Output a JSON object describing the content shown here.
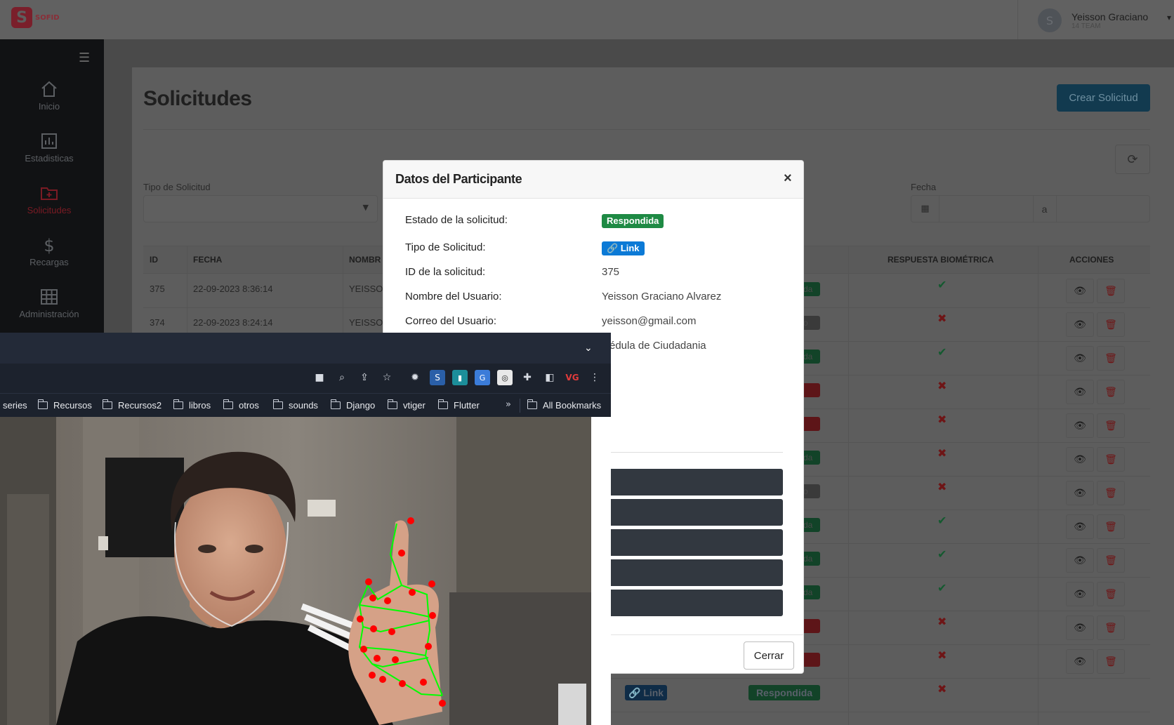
{
  "app": {
    "logo_text": "SOFID",
    "logo_letter": "S",
    "user_name": "Yeisson Graciano",
    "user_team": "14 TEAM",
    "user_initial": "S"
  },
  "sidebar": {
    "items": [
      {
        "label": "Inicio",
        "icon": "home-icon"
      },
      {
        "label": "Estadisticas",
        "icon": "chart-icon"
      },
      {
        "label": "Solicitudes",
        "icon": "folder-plus-icon"
      },
      {
        "label": "Recargas",
        "icon": "dollar-icon"
      },
      {
        "label": "Administración",
        "icon": "grid-icon"
      }
    ]
  },
  "page": {
    "title": "Solicitudes",
    "create_button": "Crear Solicitud",
    "filter_tipo_label": "Tipo de Solicitud",
    "filter_fecha_label": "Fecha",
    "date_separator": "a"
  },
  "table": {
    "headers": {
      "id": "ID",
      "fecha": "FECHA",
      "nombre": "NOMBR",
      "biometric": "RESPUESTA BIOMÉTRICA",
      "acciones": "ACCIONES"
    },
    "rows": [
      {
        "id": "375",
        "fecha": "22-09-2023 8:36:14",
        "nombre": "YEISSON",
        "edge": "da",
        "edge_color": "green",
        "ok": true
      },
      {
        "id": "374",
        "fecha": "22-09-2023 8:24:14",
        "nombre": "YEISSON",
        "edge": "o",
        "edge_color": "gray",
        "ok": false
      },
      {
        "edge": "da",
        "edge_color": "green",
        "ok": true
      },
      {
        "edge": "",
        "edge_color": "red",
        "ok": false
      },
      {
        "edge": "",
        "edge_color": "red",
        "ok": false
      },
      {
        "edge": "da",
        "edge_color": "green",
        "ok": false
      },
      {
        "edge": "o",
        "edge_color": "gray",
        "ok": false
      },
      {
        "edge": "da",
        "edge_color": "green",
        "ok": true
      },
      {
        "edge": "da",
        "edge_color": "green",
        "ok": true
      },
      {
        "edge": "da",
        "edge_color": "green",
        "ok": true
      },
      {
        "edge": "",
        "edge_color": "red",
        "ok": false
      },
      {
        "edge": "",
        "edge_color": "red",
        "ok": false
      },
      {
        "edge": "",
        "edge_color": "green",
        "ok": false
      }
    ],
    "last_row_tipo": "Link",
    "last_row_estado": "Respondida"
  },
  "modal": {
    "title": "Datos del Participante",
    "close_symbol": "×",
    "fields": [
      {
        "label": "Estado de la solicitud:",
        "value": "Respondida"
      },
      {
        "label": "Tipo de Solicitud:",
        "value": "Link"
      },
      {
        "label": "ID de la solicitud:",
        "value": "375"
      },
      {
        "label": "Nombre del Usuario:",
        "value": "Yeisson Graciano Alvarez"
      },
      {
        "label": "Correo del Usuario:",
        "value": "yeisson@gmail.com"
      },
      {
        "label": "",
        "value": "édula de Ciudadania"
      }
    ],
    "close_button": "Cerrar"
  },
  "browser": {
    "bookmarks": [
      "series",
      "Recursos",
      "Recursos2",
      "libros",
      "otros",
      "sounds",
      "Django",
      "vtiger",
      "Flutter"
    ],
    "overflow": "»",
    "all_bookmarks": "All Bookmarks"
  },
  "colors": {
    "accent_green": "#1e8a44",
    "accent_blue": "#0c7ad6",
    "danger": "#c0262d",
    "hand_landmark": "#ff0000",
    "hand_skeleton": "#00ff00"
  }
}
